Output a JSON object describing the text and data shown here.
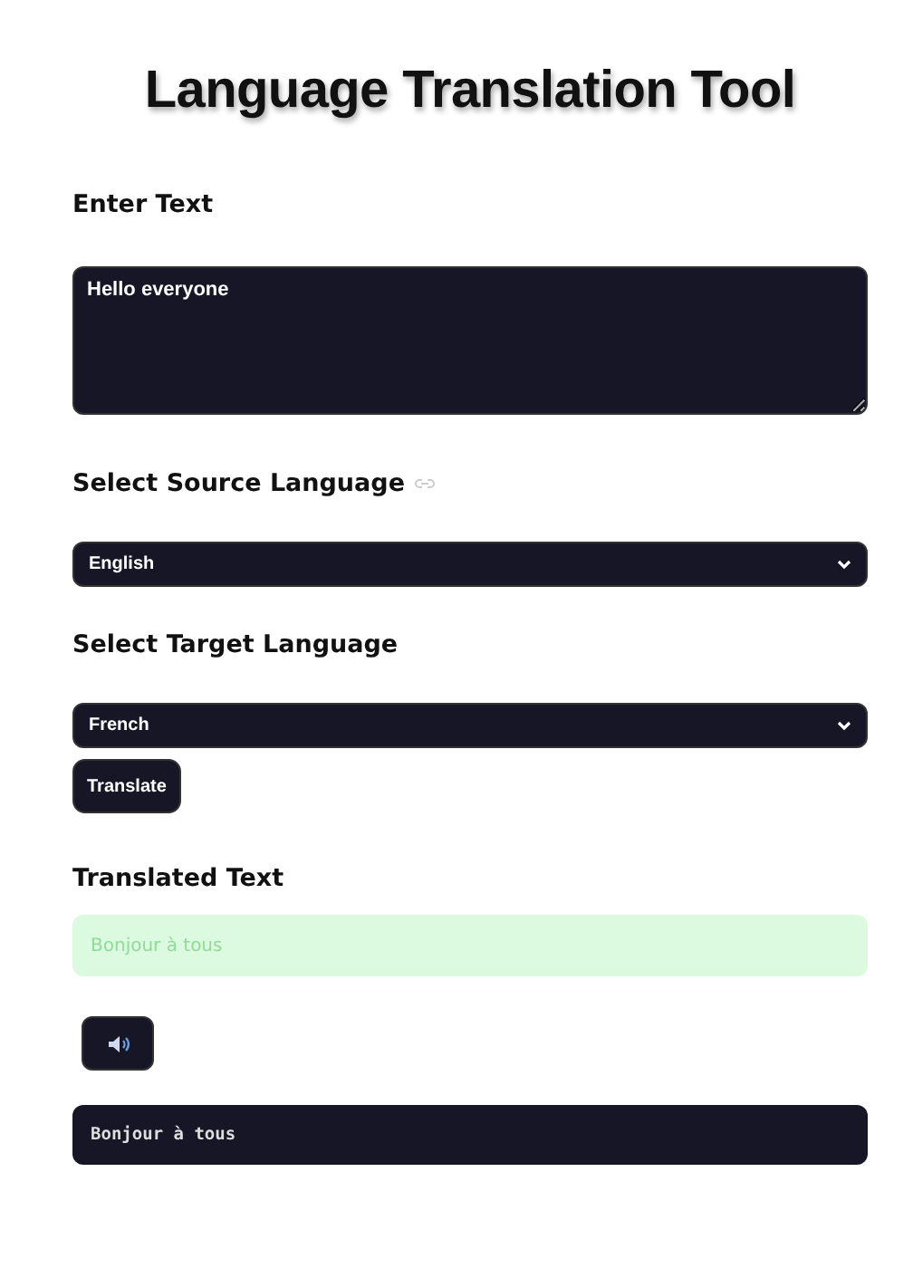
{
  "title": "Language Translation Tool",
  "input": {
    "label": "Enter Text",
    "value": "Hello everyone"
  },
  "source": {
    "label": "Select Source Language",
    "value": "English"
  },
  "target": {
    "label": "Select Target Language",
    "value": "French"
  },
  "translate_button": {
    "label": "Translate"
  },
  "result": {
    "label": "Translated Text",
    "success_message": "Bonjour à tous",
    "code_output": "Bonjour à tous"
  }
}
